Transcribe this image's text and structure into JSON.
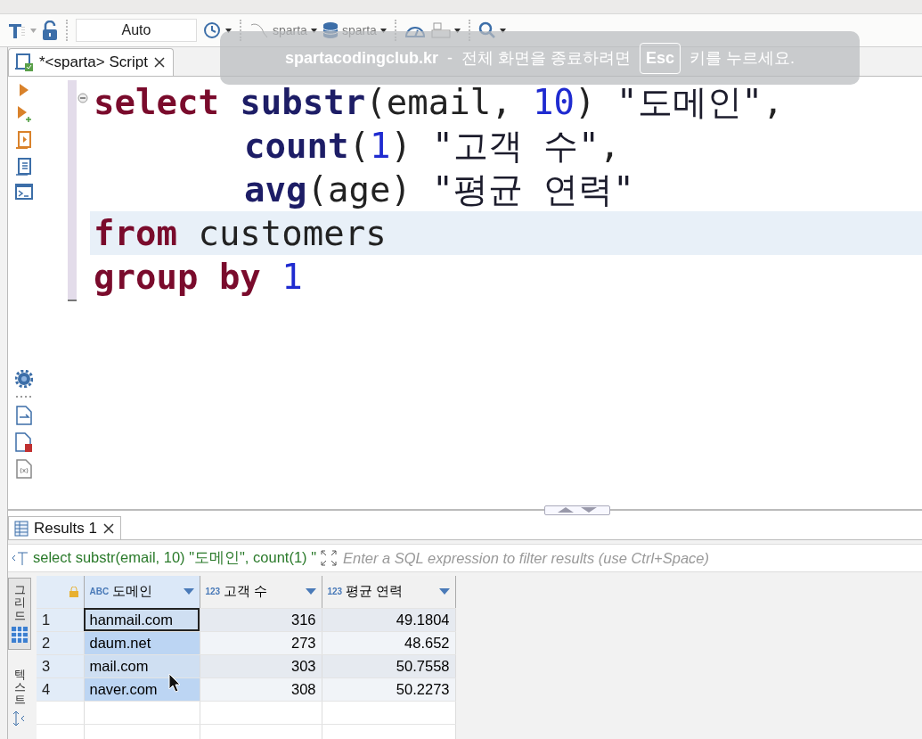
{
  "toolbar": {
    "mode_field": "Auto",
    "datasource": "sparta",
    "database": "sparta"
  },
  "editor_tab": {
    "title": "*<sparta> Script"
  },
  "code_lines": [
    {
      "kind": "clause",
      "current": false,
      "tokens": [
        {
          "kind": "keyword",
          "text": "select"
        },
        {
          "kind": "function",
          "text": " substr"
        },
        {
          "kind": "plain",
          "text": "(email, "
        },
        {
          "kind": "number",
          "text": "10"
        },
        {
          "kind": "plain",
          "text": ") "
        },
        {
          "kind": "string",
          "text": "\"도메인\""
        },
        {
          "kind": "plain",
          "text": ","
        }
      ]
    },
    {
      "kind": "continuation",
      "current": false,
      "tokens": [
        {
          "kind": "function",
          "text": "count"
        },
        {
          "kind": "plain",
          "text": "("
        },
        {
          "kind": "number",
          "text": "1"
        },
        {
          "kind": "plain",
          "text": ") "
        },
        {
          "kind": "string",
          "text": "\"고객 수\""
        },
        {
          "kind": "plain",
          "text": ","
        }
      ]
    },
    {
      "kind": "continuation",
      "current": false,
      "tokens": [
        {
          "kind": "function",
          "text": "avg"
        },
        {
          "kind": "plain",
          "text": "(age) "
        },
        {
          "kind": "string",
          "text": "\"평균 연력\""
        }
      ]
    },
    {
      "kind": "clause",
      "current": true,
      "tokens": [
        {
          "kind": "keyword",
          "text": "from"
        },
        {
          "kind": "plain",
          "text": " customers"
        }
      ]
    },
    {
      "kind": "clause",
      "current": false,
      "tokens": [
        {
          "kind": "keyword",
          "text": "group by "
        },
        {
          "kind": "number",
          "text": "1"
        }
      ]
    }
  ],
  "results": {
    "tab": "Results 1",
    "query_text": "select substr(email, 10) \"도메인\", count(1) \"",
    "filter_placeholder": "Enter a SQL expression to filter results (use Ctrl+Space)",
    "view_tabs": [
      {
        "label": "그리드",
        "selected": true
      },
      {
        "label": "텍스트",
        "selected": false
      }
    ],
    "columns": [
      {
        "type": "ABC",
        "name": "도메인",
        "selected": true
      },
      {
        "type": "123",
        "name": "고객 수",
        "selected": false
      },
      {
        "type": "123",
        "name": "평균 연력",
        "selected": false
      }
    ],
    "rows": [
      {
        "number": "1",
        "focused": true,
        "cells": [
          "hanmail.com",
          "316",
          "49.1804"
        ]
      },
      {
        "number": "2",
        "focused": false,
        "cells": [
          "daum.net",
          "273",
          "48.652"
        ]
      },
      {
        "number": "3",
        "focused": false,
        "cells": [
          "mail.com",
          "303",
          "50.7558"
        ]
      },
      {
        "number": "4",
        "focused": false,
        "cells": [
          "naver.com",
          "308",
          "50.2273"
        ]
      }
    ]
  },
  "fullscreen_notice": {
    "site": "spartacodingclub.kr",
    "separator": "-",
    "message": "전체 화면을 종료하려면",
    "key": "Esc",
    "suffix": "키를 누르세요."
  }
}
